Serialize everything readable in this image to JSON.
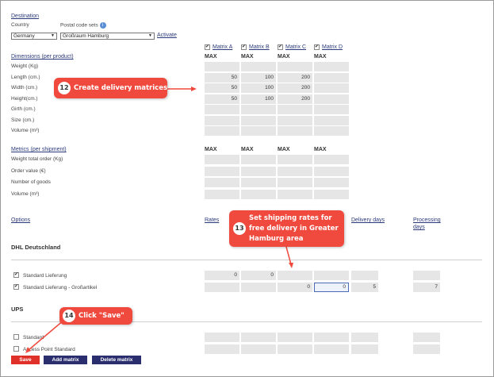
{
  "destination": {
    "section_title": "Destination",
    "country_label": "Country",
    "postal_label": "Postal code sets",
    "info_icon": "i",
    "country_value": "Germany",
    "postal_value": "Großraum Hamburg",
    "activate_link": "Activate"
  },
  "matrices": [
    {
      "label": "Matrix A",
      "checked": true
    },
    {
      "label": "Matrix B",
      "checked": true
    },
    {
      "label": "Matrix C",
      "checked": true
    },
    {
      "label": "Matrix D",
      "checked": true
    }
  ],
  "max_label": "MAX",
  "dimensions": {
    "title": "Dimensions (per product)",
    "rows": [
      {
        "label": "Weight (Kg)",
        "values": [
          "",
          "",
          "",
          ""
        ]
      },
      {
        "label": "Length (cm.)",
        "values": [
          "50",
          "100",
          "200",
          ""
        ]
      },
      {
        "label": "Width (cm.)",
        "values": [
          "50",
          "100",
          "200",
          ""
        ]
      },
      {
        "label": "Height(cm.)",
        "values": [
          "50",
          "100",
          "200",
          ""
        ]
      },
      {
        "label": "Girth (cm.)",
        "values": [
          "",
          "",
          "",
          ""
        ]
      },
      {
        "label": "Size (cm.)",
        "values": [
          "",
          "",
          "",
          ""
        ]
      },
      {
        "label": "Volume (m³)",
        "values": [
          "",
          "",
          "",
          ""
        ]
      }
    ]
  },
  "metrics": {
    "title": "Metrics (per shipment)",
    "rows": [
      {
        "label": "Weight total order (Kg)",
        "values": [
          "",
          "",
          "",
          ""
        ]
      },
      {
        "label": "Order value (€)",
        "values": [
          "",
          "",
          "",
          ""
        ]
      },
      {
        "label": "Number of goods",
        "values": [
          "",
          "",
          "",
          ""
        ]
      },
      {
        "label": "Volume (m³)",
        "values": [
          "",
          "",
          "",
          ""
        ]
      }
    ]
  },
  "options_header": {
    "options": "Options",
    "rates": "Rates",
    "delivery_days": "Delivery days",
    "processing_days_1": "Processing",
    "processing_days_2": "days"
  },
  "carriers": [
    {
      "name": "DHL Deutschland",
      "options": [
        {
          "label": "Standard Lieferung",
          "checked": true,
          "rates": [
            "0",
            "0",
            "",
            ""
          ],
          "delivery": "",
          "processing": ""
        },
        {
          "label": "Standard Lieferung - Großartikel",
          "checked": true,
          "rates": [
            "",
            "",
            "0",
            "0"
          ],
          "delivery": "5",
          "processing": "7"
        }
      ]
    },
    {
      "name": "UPS",
      "options": [
        {
          "label": "Standard",
          "checked": false,
          "rates": [
            "",
            "",
            "",
            ""
          ],
          "delivery": "",
          "processing": ""
        },
        {
          "label": "Access Point Standard",
          "checked": false,
          "rates": [
            "",
            "",
            "",
            ""
          ],
          "delivery": "",
          "processing": ""
        }
      ]
    }
  ],
  "buttons": {
    "save": "Save",
    "add_matrix": "Add matrix",
    "delete_matrix": "Delete matrix"
  },
  "callouts": {
    "c12": {
      "num": "12",
      "text": "Create delivery matrices"
    },
    "c13": {
      "num": "13",
      "line1": "Set shipping rates for",
      "line2": "free delivery in Greater",
      "line3": "Hamburg area"
    },
    "c14": {
      "num": "14",
      "text": "Click \"Save\""
    }
  },
  "colors": {
    "callout": "#f04a3e",
    "save_button": "#e0302a",
    "dark_button": "#2b2e6e",
    "link": "#2b3a7a",
    "input_gray": "#e6e6e6"
  }
}
